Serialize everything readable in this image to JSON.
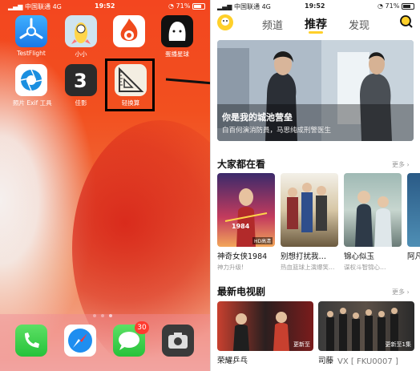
{
  "left_phone": {
    "status": {
      "carrier": "中国联通",
      "network": "4G",
      "time": "19:52",
      "battery": "71%"
    },
    "apps": [
      {
        "label": "TestFlight",
        "icon": "testflight-icon"
      },
      {
        "label": "小小",
        "icon": "rocket-character-icon"
      },
      {
        "label": "",
        "icon": "fire-telephone-icon"
      },
      {
        "label": "蛋播星球",
        "icon": "white-ghost-icon"
      },
      {
        "label": "照片 Exif 工具",
        "icon": "camera-aperture-icon"
      },
      {
        "label": "佳影",
        "icon": "jiaying-logo-icon"
      },
      {
        "label": "轻换算",
        "icon": "ruler-triangle-icon"
      }
    ],
    "dock": [
      {
        "icon": "phone-icon"
      },
      {
        "icon": "safari-compass-icon"
      },
      {
        "icon": "messages-icon",
        "badge": "30"
      },
      {
        "icon": "camera-icon"
      }
    ],
    "page_dots": 3,
    "active_dot": 3
  },
  "right_phone": {
    "status": {
      "carrier": "中国联通",
      "network": "4G",
      "time": "19:52",
      "battery": "71%"
    },
    "tabs": [
      "频道",
      "推荐",
      "发现"
    ],
    "active_tab": 1,
    "banner": {
      "title": "你是我的城池营垒",
      "subtitle": "白百何演消防員，马思纯成刑警医生"
    },
    "section1": {
      "title": "大家都在看",
      "more": "更多",
      "cards": [
        {
          "title": "神奇女侠1984",
          "sub": "神力升级!",
          "badge": "HD高清"
        },
        {
          "title": "别想打扰我…",
          "sub": "热血篮球上演爆笑…"
        },
        {
          "title": "锦心似玉",
          "sub": "谋权斗智锦心…"
        },
        {
          "title": "阿凡",
          "sub": ""
        }
      ]
    },
    "section2": {
      "title": "最新电视剧",
      "more": "更多",
      "cards": [
        {
          "title": "荣耀乒乓",
          "overlay": "更新至"
        },
        {
          "title": "司藤",
          "overlay": "更新至1集"
        }
      ]
    },
    "watermark": "VX [ FKU0007 ]"
  },
  "colors": {
    "accent_yellow": "#ffd02a",
    "highlight_box": "#000000",
    "badge_red": "#ff3b30"
  }
}
